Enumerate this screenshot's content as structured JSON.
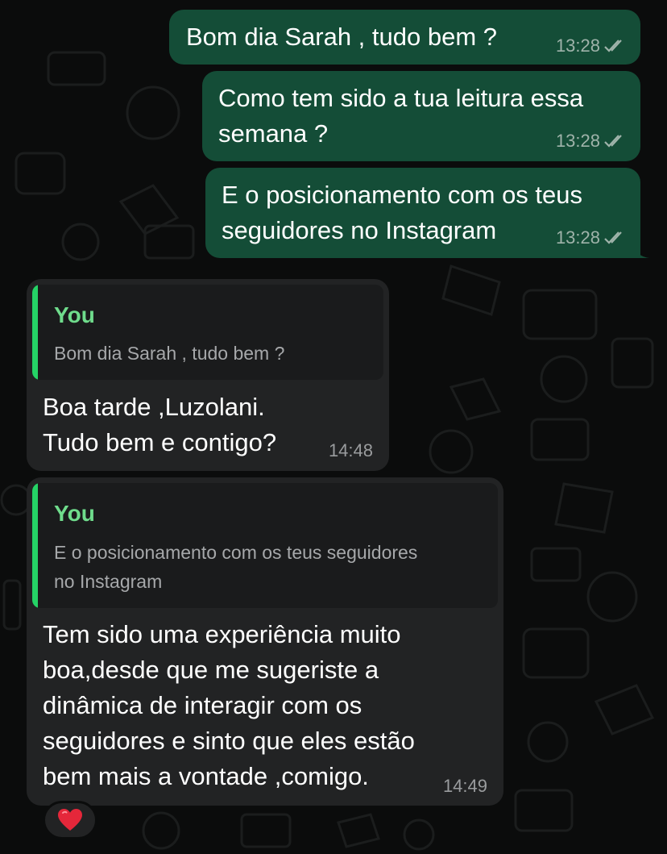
{
  "messages": [
    {
      "direction": "outgoing",
      "text": "Bom dia Sarah , tudo bem ?",
      "time": "13:28",
      "status": "read"
    },
    {
      "direction": "outgoing",
      "line1": "Como tem sido a tua leitura essa",
      "line2": "semana ?",
      "time": "13:28",
      "status": "read"
    },
    {
      "direction": "outgoing",
      "line1": "E o posicionamento com os teus",
      "line2": "seguidores no Instagram",
      "time": "13:28",
      "status": "read"
    },
    {
      "direction": "incoming",
      "quote": {
        "author": "You",
        "text": "Bom dia Sarah , tudo bem ?"
      },
      "line1": "Boa tarde ,Luzolani.",
      "line2": "Tudo bem e contigo?",
      "time": "14:48"
    },
    {
      "direction": "incoming",
      "quote": {
        "author": "You",
        "line1": "E o posicionamento com os teus seguidores",
        "line2": "no Instagram"
      },
      "line1": "Tem sido uma experiência muito",
      "line2": "boa,desde que me sugeriste a",
      "line3": "dinâmica de interagir com os",
      "line4": "seguidores e sinto que eles estão",
      "line5": "bem mais a vontade ,comigo.",
      "time": "14:49",
      "reaction": "heart-emoji"
    }
  ],
  "colors": {
    "outgoing_bubble": "#144d37",
    "incoming_bubble": "#222324",
    "quote_accent": "#25d366",
    "background": "#0b0c0c"
  }
}
